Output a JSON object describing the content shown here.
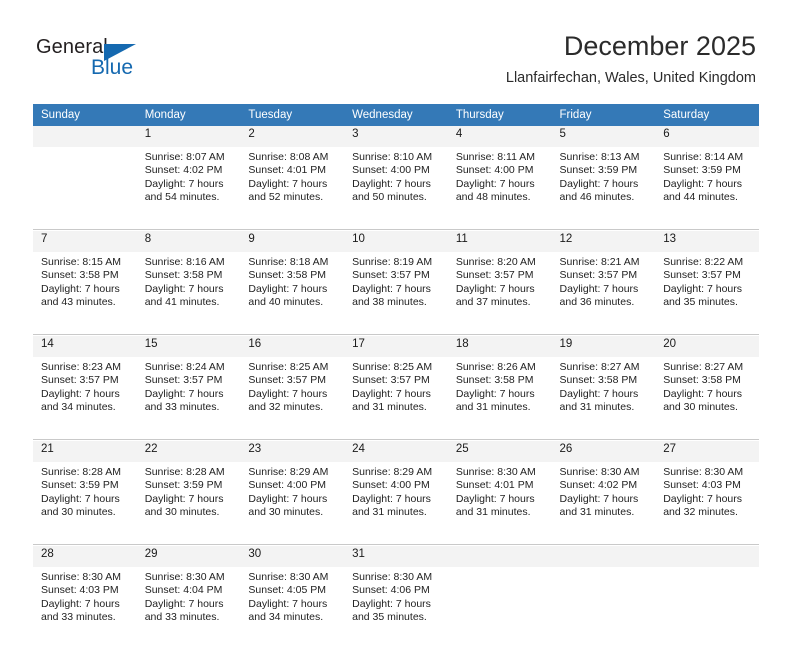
{
  "brand": {
    "name_part1": "General",
    "name_part2": "Blue",
    "accent_color": "#1569b0",
    "triangle_icon": "logo-triangle-icon"
  },
  "header": {
    "title": "December 2025",
    "subtitle": "Llanfairfechan, Wales, United Kingdom"
  },
  "calendar": {
    "header_bg": "#3479b7",
    "daynum_bg": "#f3f3f3",
    "weekdays": [
      "Sunday",
      "Monday",
      "Tuesday",
      "Wednesday",
      "Thursday",
      "Friday",
      "Saturday"
    ],
    "weeks": [
      [
        {
          "day": "",
          "sunrise": "",
          "sunset": "",
          "daylight_line1": "",
          "daylight_line2": ""
        },
        {
          "day": "1",
          "sunrise": "Sunrise: 8:07 AM",
          "sunset": "Sunset: 4:02 PM",
          "daylight_line1": "Daylight: 7 hours",
          "daylight_line2": "and 54 minutes."
        },
        {
          "day": "2",
          "sunrise": "Sunrise: 8:08 AM",
          "sunset": "Sunset: 4:01 PM",
          "daylight_line1": "Daylight: 7 hours",
          "daylight_line2": "and 52 minutes."
        },
        {
          "day": "3",
          "sunrise": "Sunrise: 8:10 AM",
          "sunset": "Sunset: 4:00 PM",
          "daylight_line1": "Daylight: 7 hours",
          "daylight_line2": "and 50 minutes."
        },
        {
          "day": "4",
          "sunrise": "Sunrise: 8:11 AM",
          "sunset": "Sunset: 4:00 PM",
          "daylight_line1": "Daylight: 7 hours",
          "daylight_line2": "and 48 minutes."
        },
        {
          "day": "5",
          "sunrise": "Sunrise: 8:13 AM",
          "sunset": "Sunset: 3:59 PM",
          "daylight_line1": "Daylight: 7 hours",
          "daylight_line2": "and 46 minutes."
        },
        {
          "day": "6",
          "sunrise": "Sunrise: 8:14 AM",
          "sunset": "Sunset: 3:59 PM",
          "daylight_line1": "Daylight: 7 hours",
          "daylight_line2": "and 44 minutes."
        }
      ],
      [
        {
          "day": "7",
          "sunrise": "Sunrise: 8:15 AM",
          "sunset": "Sunset: 3:58 PM",
          "daylight_line1": "Daylight: 7 hours",
          "daylight_line2": "and 43 minutes."
        },
        {
          "day": "8",
          "sunrise": "Sunrise: 8:16 AM",
          "sunset": "Sunset: 3:58 PM",
          "daylight_line1": "Daylight: 7 hours",
          "daylight_line2": "and 41 minutes."
        },
        {
          "day": "9",
          "sunrise": "Sunrise: 8:18 AM",
          "sunset": "Sunset: 3:58 PM",
          "daylight_line1": "Daylight: 7 hours",
          "daylight_line2": "and 40 minutes."
        },
        {
          "day": "10",
          "sunrise": "Sunrise: 8:19 AM",
          "sunset": "Sunset: 3:57 PM",
          "daylight_line1": "Daylight: 7 hours",
          "daylight_line2": "and 38 minutes."
        },
        {
          "day": "11",
          "sunrise": "Sunrise: 8:20 AM",
          "sunset": "Sunset: 3:57 PM",
          "daylight_line1": "Daylight: 7 hours",
          "daylight_line2": "and 37 minutes."
        },
        {
          "day": "12",
          "sunrise": "Sunrise: 8:21 AM",
          "sunset": "Sunset: 3:57 PM",
          "daylight_line1": "Daylight: 7 hours",
          "daylight_line2": "and 36 minutes."
        },
        {
          "day": "13",
          "sunrise": "Sunrise: 8:22 AM",
          "sunset": "Sunset: 3:57 PM",
          "daylight_line1": "Daylight: 7 hours",
          "daylight_line2": "and 35 minutes."
        }
      ],
      [
        {
          "day": "14",
          "sunrise": "Sunrise: 8:23 AM",
          "sunset": "Sunset: 3:57 PM",
          "daylight_line1": "Daylight: 7 hours",
          "daylight_line2": "and 34 minutes."
        },
        {
          "day": "15",
          "sunrise": "Sunrise: 8:24 AM",
          "sunset": "Sunset: 3:57 PM",
          "daylight_line1": "Daylight: 7 hours",
          "daylight_line2": "and 33 minutes."
        },
        {
          "day": "16",
          "sunrise": "Sunrise: 8:25 AM",
          "sunset": "Sunset: 3:57 PM",
          "daylight_line1": "Daylight: 7 hours",
          "daylight_line2": "and 32 minutes."
        },
        {
          "day": "17",
          "sunrise": "Sunrise: 8:25 AM",
          "sunset": "Sunset: 3:57 PM",
          "daylight_line1": "Daylight: 7 hours",
          "daylight_line2": "and 31 minutes."
        },
        {
          "day": "18",
          "sunrise": "Sunrise: 8:26 AM",
          "sunset": "Sunset: 3:58 PM",
          "daylight_line1": "Daylight: 7 hours",
          "daylight_line2": "and 31 minutes."
        },
        {
          "day": "19",
          "sunrise": "Sunrise: 8:27 AM",
          "sunset": "Sunset: 3:58 PM",
          "daylight_line1": "Daylight: 7 hours",
          "daylight_line2": "and 31 minutes."
        },
        {
          "day": "20",
          "sunrise": "Sunrise: 8:27 AM",
          "sunset": "Sunset: 3:58 PM",
          "daylight_line1": "Daylight: 7 hours",
          "daylight_line2": "and 30 minutes."
        }
      ],
      [
        {
          "day": "21",
          "sunrise": "Sunrise: 8:28 AM",
          "sunset": "Sunset: 3:59 PM",
          "daylight_line1": "Daylight: 7 hours",
          "daylight_line2": "and 30 minutes."
        },
        {
          "day": "22",
          "sunrise": "Sunrise: 8:28 AM",
          "sunset": "Sunset: 3:59 PM",
          "daylight_line1": "Daylight: 7 hours",
          "daylight_line2": "and 30 minutes."
        },
        {
          "day": "23",
          "sunrise": "Sunrise: 8:29 AM",
          "sunset": "Sunset: 4:00 PM",
          "daylight_line1": "Daylight: 7 hours",
          "daylight_line2": "and 30 minutes."
        },
        {
          "day": "24",
          "sunrise": "Sunrise: 8:29 AM",
          "sunset": "Sunset: 4:00 PM",
          "daylight_line1": "Daylight: 7 hours",
          "daylight_line2": "and 31 minutes."
        },
        {
          "day": "25",
          "sunrise": "Sunrise: 8:30 AM",
          "sunset": "Sunset: 4:01 PM",
          "daylight_line1": "Daylight: 7 hours",
          "daylight_line2": "and 31 minutes."
        },
        {
          "day": "26",
          "sunrise": "Sunrise: 8:30 AM",
          "sunset": "Sunset: 4:02 PM",
          "daylight_line1": "Daylight: 7 hours",
          "daylight_line2": "and 31 minutes."
        },
        {
          "day": "27",
          "sunrise": "Sunrise: 8:30 AM",
          "sunset": "Sunset: 4:03 PM",
          "daylight_line1": "Daylight: 7 hours",
          "daylight_line2": "and 32 minutes."
        }
      ],
      [
        {
          "day": "28",
          "sunrise": "Sunrise: 8:30 AM",
          "sunset": "Sunset: 4:03 PM",
          "daylight_line1": "Daylight: 7 hours",
          "daylight_line2": "and 33 minutes."
        },
        {
          "day": "29",
          "sunrise": "Sunrise: 8:30 AM",
          "sunset": "Sunset: 4:04 PM",
          "daylight_line1": "Daylight: 7 hours",
          "daylight_line2": "and 33 minutes."
        },
        {
          "day": "30",
          "sunrise": "Sunrise: 8:30 AM",
          "sunset": "Sunset: 4:05 PM",
          "daylight_line1": "Daylight: 7 hours",
          "daylight_line2": "and 34 minutes."
        },
        {
          "day": "31",
          "sunrise": "Sunrise: 8:30 AM",
          "sunset": "Sunset: 4:06 PM",
          "daylight_line1": "Daylight: 7 hours",
          "daylight_line2": "and 35 minutes."
        },
        {
          "day": "",
          "sunrise": "",
          "sunset": "",
          "daylight_line1": "",
          "daylight_line2": ""
        },
        {
          "day": "",
          "sunrise": "",
          "sunset": "",
          "daylight_line1": "",
          "daylight_line2": ""
        },
        {
          "day": "",
          "sunrise": "",
          "sunset": "",
          "daylight_line1": "",
          "daylight_line2": ""
        }
      ]
    ]
  }
}
